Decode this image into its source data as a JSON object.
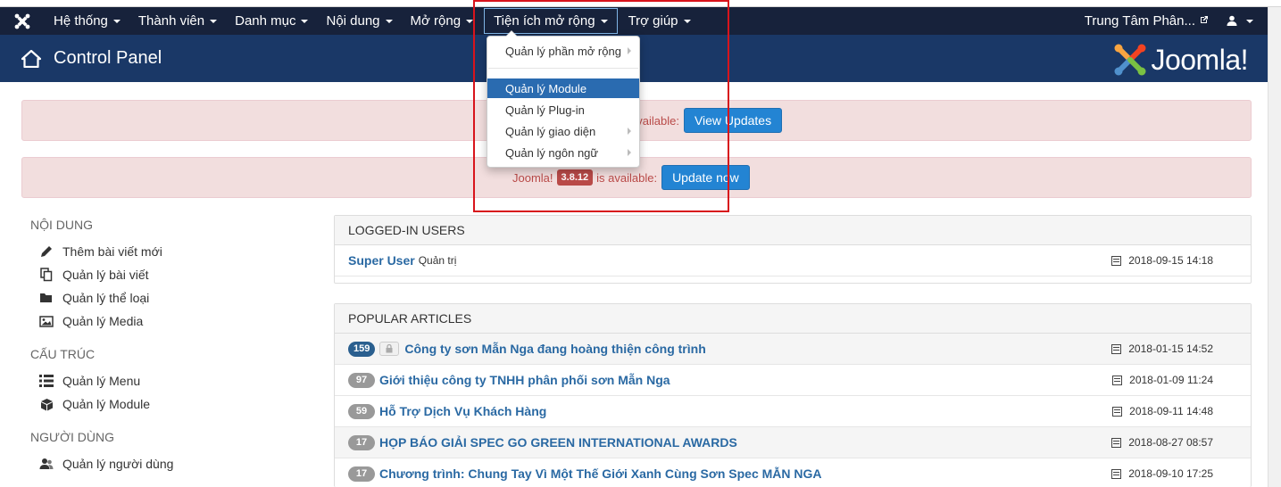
{
  "colors": {
    "navbar_bg": "#17223b",
    "header_bg": "#1a3867",
    "alert_bg": "#f2dede",
    "alert_text": "#b94a48",
    "button_blue": "#2384d3",
    "link": "#2a69a3",
    "annotation_red": "#d8141c",
    "dropdown_highlight": "#2a6bb0"
  },
  "navbar": {
    "logo_icon": "joomla-x-icon",
    "items": [
      {
        "label": "Hệ thống"
      },
      {
        "label": "Thành viên"
      },
      {
        "label": "Danh mục"
      },
      {
        "label": "Nội dung"
      },
      {
        "label": "Mở rộng"
      },
      {
        "label": "Tiện ích mở rộng"
      },
      {
        "label": "Trợ giúp"
      }
    ],
    "site_name": "Trung Tâm Phân...",
    "user_icon": "user-icon"
  },
  "header": {
    "title": "Control Panel",
    "logo_text": "Joomla!"
  },
  "dropdown": {
    "items": [
      {
        "label": "Quản lý phần mở rộng",
        "has_submenu": true
      },
      {
        "label": "Quản lý Module",
        "has_submenu": false,
        "highlighted": true
      },
      {
        "label": "Quản lý Plug-in",
        "has_submenu": false
      },
      {
        "label": "Quản lý giao diện",
        "has_submenu": true
      },
      {
        "label": "Quản lý ngôn ngữ",
        "has_submenu": true
      }
    ]
  },
  "alerts": [
    {
      "text": "available:",
      "button": "View Updates"
    },
    {
      "prefix": "Joomla!",
      "version": "3.8.12",
      "suffix": "is available:",
      "button": "Update now"
    }
  ],
  "sidebar": {
    "sections": [
      {
        "heading": "NỘI DUNG",
        "items": [
          {
            "label": "Thêm bài viết mới",
            "icon": "pencil-icon"
          },
          {
            "label": "Quản lý bài viết",
            "icon": "copy-icon"
          },
          {
            "label": "Quản lý thể loại",
            "icon": "folder-icon"
          },
          {
            "label": "Quản lý Media",
            "icon": "image-icon"
          }
        ]
      },
      {
        "heading": "CẤU TRÚC",
        "items": [
          {
            "label": "Quản lý Menu",
            "icon": "list-icon"
          },
          {
            "label": "Quản lý Module",
            "icon": "cube-icon"
          }
        ]
      },
      {
        "heading": "NGƯỜI DÙNG",
        "items": [
          {
            "label": "Quản lý người dùng",
            "icon": "users-icon"
          }
        ]
      }
    ]
  },
  "logged_in_users": {
    "title": "LOGGED-IN USERS",
    "rows": [
      {
        "name": "Super User",
        "role": "Quản trị",
        "date": "2018-09-15 14:18"
      }
    ]
  },
  "popular_articles": {
    "title": "POPULAR ARTICLES",
    "rows": [
      {
        "hits": "159",
        "locked": true,
        "title": "Công ty sơn Mẫn Nga đang hoàng thiện công trình",
        "date": "2018-01-15 14:52"
      },
      {
        "hits": "97",
        "locked": false,
        "title": "Giới thiệu công ty TNHH phân phối sơn Mẫn Nga",
        "date": "2018-01-09 11:24"
      },
      {
        "hits": "59",
        "locked": false,
        "title": "Hỗ Trợ Dịch Vụ Khách Hàng",
        "date": "2018-09-11 14:48"
      },
      {
        "hits": "17",
        "locked": false,
        "title": "HỌP BÁO GIẢI SPEC GO GREEN INTERNATIONAL AWARDS",
        "date": "2018-08-27 08:57"
      },
      {
        "hits": "17",
        "locked": false,
        "title": "Chương trình: Chung Tay Vì Một Thế Giới Xanh Cùng Sơn Spec MẪN NGA",
        "date": "2018-09-10 17:25"
      }
    ]
  }
}
